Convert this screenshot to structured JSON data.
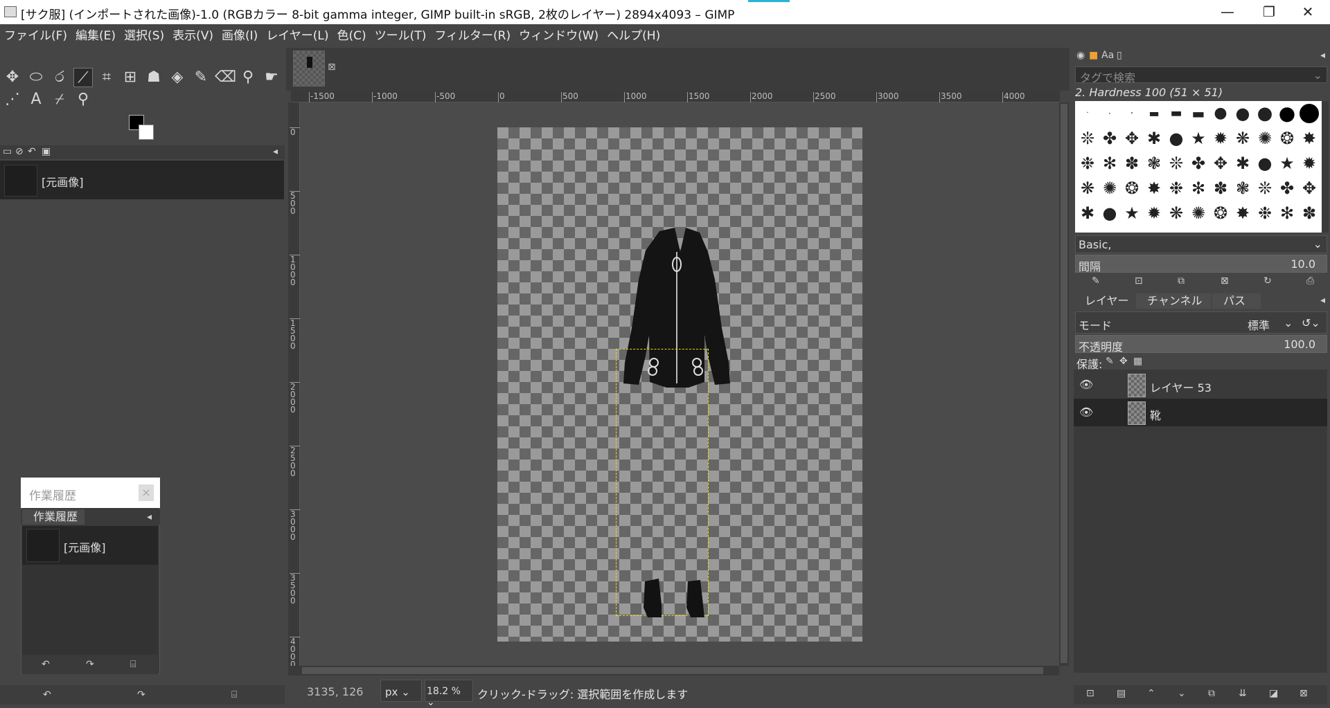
{
  "window": {
    "title": "[サク服] (インポートされた画像)-1.0 (RGBカラー 8-bit gamma integer, GIMP built-in sRGB, 2枚のレイヤー) 2894x4093 – GIMP",
    "minimize": "—",
    "maximize": "❐",
    "close": "✕"
  },
  "menu": [
    "ファイル(F)",
    "編集(E)",
    "選択(S)",
    "表示(V)",
    "画像(I)",
    "レイヤー(L)",
    "色(C)",
    "ツール(T)",
    "フィルター(R)",
    "ウィンドウ(W)",
    "ヘルプ(H)"
  ],
  "tools": [
    {
      "name": "move-tool-icon",
      "glyph": "✥"
    },
    {
      "name": "ellipse-select-icon",
      "glyph": "⬭"
    },
    {
      "name": "free-select-icon",
      "glyph": "ර"
    },
    {
      "name": "fuzzy-select-icon",
      "glyph": "⟋"
    },
    {
      "name": "crop-icon",
      "glyph": "⌗"
    },
    {
      "name": "unified-transform-icon",
      "glyph": "⊞"
    },
    {
      "name": "warp-transform-icon",
      "glyph": "☗"
    },
    {
      "name": "bucket-fill-icon",
      "glyph": "◈"
    },
    {
      "name": "paintbrush-icon",
      "glyph": "✎"
    },
    {
      "name": "eraser-icon",
      "glyph": "⌫"
    },
    {
      "name": "clone-icon",
      "glyph": "⚲"
    },
    {
      "name": "smudge-icon",
      "glyph": "☛"
    },
    {
      "name": "paths-icon",
      "glyph": "⋰"
    },
    {
      "name": "text-tool-icon",
      "glyph": "A"
    },
    {
      "name": "color-picker-icon",
      "glyph": "⌿"
    },
    {
      "name": "zoom-icon",
      "glyph": "⚲"
    }
  ],
  "images_panel": {
    "item": "[元画像]"
  },
  "history_float": {
    "title": "作業履歴",
    "close": "×",
    "tab": "作業履歴",
    "item": "[元画像]"
  },
  "rulers": {
    "h_labels": [
      "-1500",
      "-1000",
      "-500",
      "0",
      "500",
      "1000",
      "1500",
      "2000",
      "2500",
      "3000",
      "3500",
      "4000"
    ],
    "v_labels": [
      "0",
      "500",
      "1000",
      "1500",
      "2000",
      "2500",
      "3000",
      "3500",
      "4000"
    ]
  },
  "tab_close": "⊠",
  "status": {
    "coords": "3135, 126",
    "unit": "px",
    "zoom": "18.2 %",
    "hint": "クリック-ドラッグ: 選択範囲を作成します"
  },
  "brushes": {
    "search_placeholder": "タグで検索",
    "current": "2. Hardness 100 (51 × 51)",
    "tag": "Basic,",
    "spacing_label": "間隔",
    "spacing_value": "10.0"
  },
  "layers_panel": {
    "tabs": [
      "レイヤー",
      "チャンネル",
      "パス"
    ],
    "mode_label": "モード",
    "mode_value": "標準",
    "opacity_label": "不透明度",
    "opacity_value": "100.0",
    "lock_label": "保護:",
    "layers": [
      {
        "name": "レイヤー 53",
        "visible": true
      },
      {
        "name": "靴",
        "visible": true
      }
    ]
  },
  "colors": {
    "foreground": "#000000",
    "background": "#ffffff",
    "selection": "#e8e000"
  }
}
